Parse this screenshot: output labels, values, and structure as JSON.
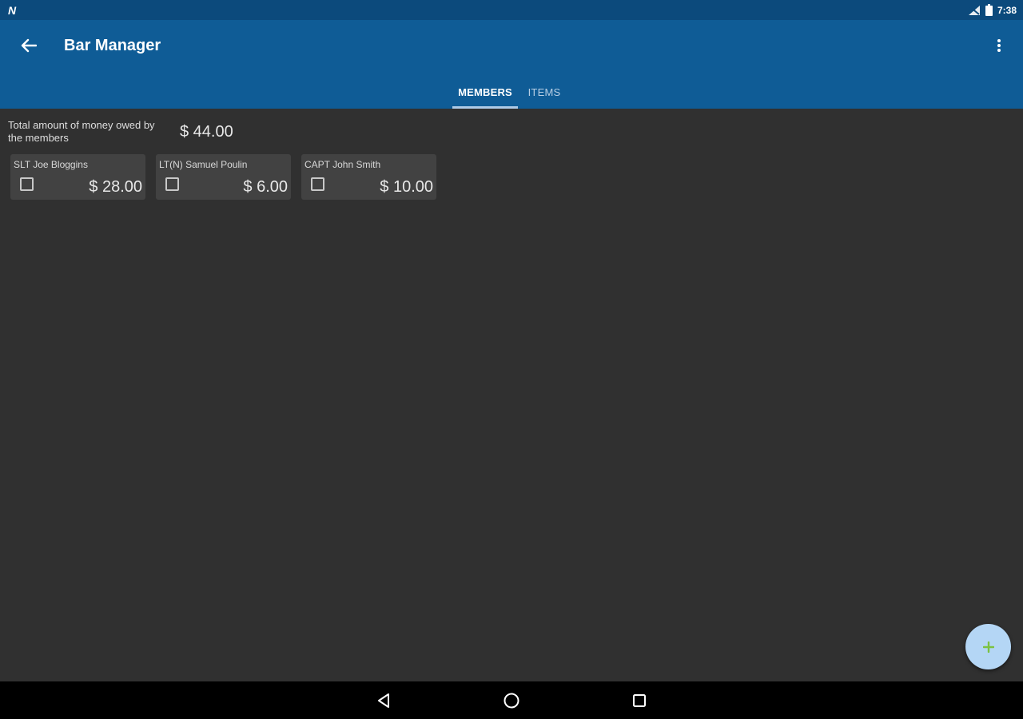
{
  "status_bar": {
    "time": "7:38",
    "notification_icon": "n-logo-icon"
  },
  "app_bar": {
    "title": "Bar Manager",
    "back_icon": "arrow-back-icon",
    "overflow_icon": "more-vert-icon",
    "color": "#0f5c96"
  },
  "tabs": [
    {
      "label": "MEMBERS",
      "selected": true
    },
    {
      "label": "ITEMS",
      "selected": false
    }
  ],
  "summary": {
    "label": "Total amount of money owed by the members",
    "amount": "$ 44.00"
  },
  "members": [
    {
      "name": "SLT Joe Bloggins",
      "amount": "$ 28.00",
      "checked": false
    },
    {
      "name": "LT(N) Samuel Poulin",
      "amount": "$ 6.00",
      "checked": false
    },
    {
      "name": "CAPT John Smith",
      "amount": "$ 10.00",
      "checked": false
    }
  ],
  "fab": {
    "icon": "add-icon",
    "background": "#b4d6f5",
    "icon_color": "#7cc241"
  },
  "nav_bar": {
    "buttons": [
      "back-triangle-icon",
      "home-circle-icon",
      "recents-square-icon"
    ]
  }
}
